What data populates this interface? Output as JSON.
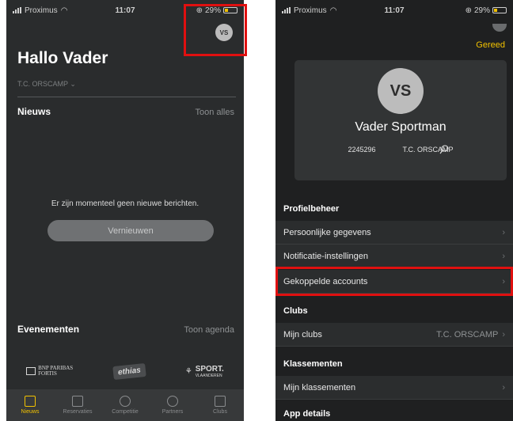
{
  "status": {
    "carrier": "Proximus",
    "time": "11:07",
    "battery": "29%"
  },
  "left": {
    "avatar_initials": "VS",
    "greeting": "Hallo Vader",
    "club_selector": "T.C. ORSCAMP",
    "news": {
      "title": "Nieuws",
      "link": "Toon alles"
    },
    "empty_message": "Er zijn momenteel geen nieuwe berichten.",
    "refresh_label": "Vernieuwen",
    "events": {
      "title": "Evenementen",
      "link": "Toon agenda"
    },
    "sponsors": {
      "bnp_line1": "BNP PARIBAS",
      "bnp_line2": "FORTIS",
      "ethias": "ethias",
      "sport_line1": "SPORT.",
      "sport_line2": "VLAANDEREN"
    },
    "tabs": [
      {
        "label": "Nieuws",
        "icon": "news-icon"
      },
      {
        "label": "Reservaties",
        "icon": "calendar-icon"
      },
      {
        "label": "Competitie",
        "icon": "ball-icon"
      },
      {
        "label": "Partners",
        "icon": "handshake-icon"
      },
      {
        "label": "Clubs",
        "icon": "clubs-icon"
      }
    ],
    "active_tab_color": "#f2c200"
  },
  "right": {
    "done_label": "Gereed",
    "avatar_initials": "VS",
    "name": "Vader Sportman",
    "member_number": "2245296",
    "club": "T.C. ORSCAMP",
    "sections": {
      "profile": "Profielbeheer",
      "clubs": "Clubs",
      "rankings": "Klassementen",
      "app": "App details"
    },
    "rows": {
      "personal": "Persoonlijke gegevens",
      "notifications": "Notificatie-instellingen",
      "linked": "Gekoppelde accounts",
      "my_clubs": "Mijn clubs",
      "my_clubs_value": "T.C. ORSCAMP",
      "my_rankings": "Mijn klassementen"
    }
  },
  "highlight_color": "#e01010"
}
